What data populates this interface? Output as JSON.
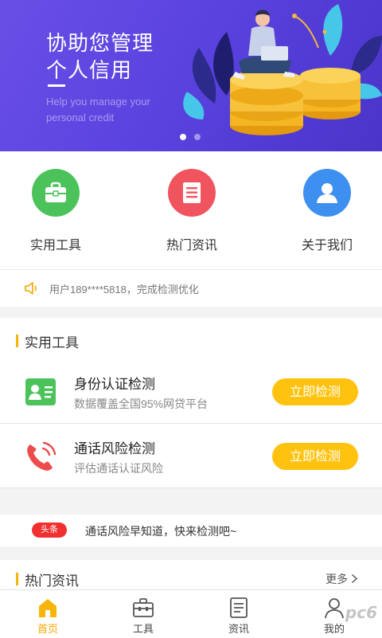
{
  "banner": {
    "title_line1": "协助您管理",
    "title_line2": "个人信用",
    "subtitle_line1": "Help you manage your",
    "subtitle_line2": "personal credit",
    "slide_count": 2,
    "active_slide": 1
  },
  "quick_menu": [
    {
      "label": "实用工具",
      "icon": "toolbox-icon",
      "color": "#4cc35a"
    },
    {
      "label": "热门资讯",
      "icon": "news-icon",
      "color": "#f0555f"
    },
    {
      "label": "关于我们",
      "icon": "user-icon",
      "color": "#3d8ff0"
    }
  ],
  "notice": {
    "icon": "speaker-icon",
    "text": "用户189****5818，完成检测优化"
  },
  "tools_section": {
    "title": "实用工具",
    "items": [
      {
        "title": "身份认证检测",
        "desc": "数据覆盖全国95%网贷平台",
        "button": "立即检测",
        "icon": "id-card-icon"
      },
      {
        "title": "通话风险检测",
        "desc": "评估通话认证风险",
        "button": "立即检测",
        "icon": "phone-icon"
      }
    ]
  },
  "headline": {
    "badge": "头条",
    "text": "通话风险早知道，快来检测吧~"
  },
  "news_section": {
    "title": "热门资讯",
    "more": "更多"
  },
  "tabbar": [
    {
      "label": "首页",
      "icon": "home-icon",
      "active": true
    },
    {
      "label": "工具",
      "icon": "toolbox-icon",
      "active": false
    },
    {
      "label": "资讯",
      "icon": "document-icon",
      "active": false
    },
    {
      "label": "我的",
      "icon": "person-icon",
      "active": false
    }
  ],
  "watermark": "pc6",
  "colors": {
    "banner": "#5b43e0",
    "accent": "#ffc20e",
    "badge": "#f0302e",
    "active_tab": "#f5a700"
  }
}
